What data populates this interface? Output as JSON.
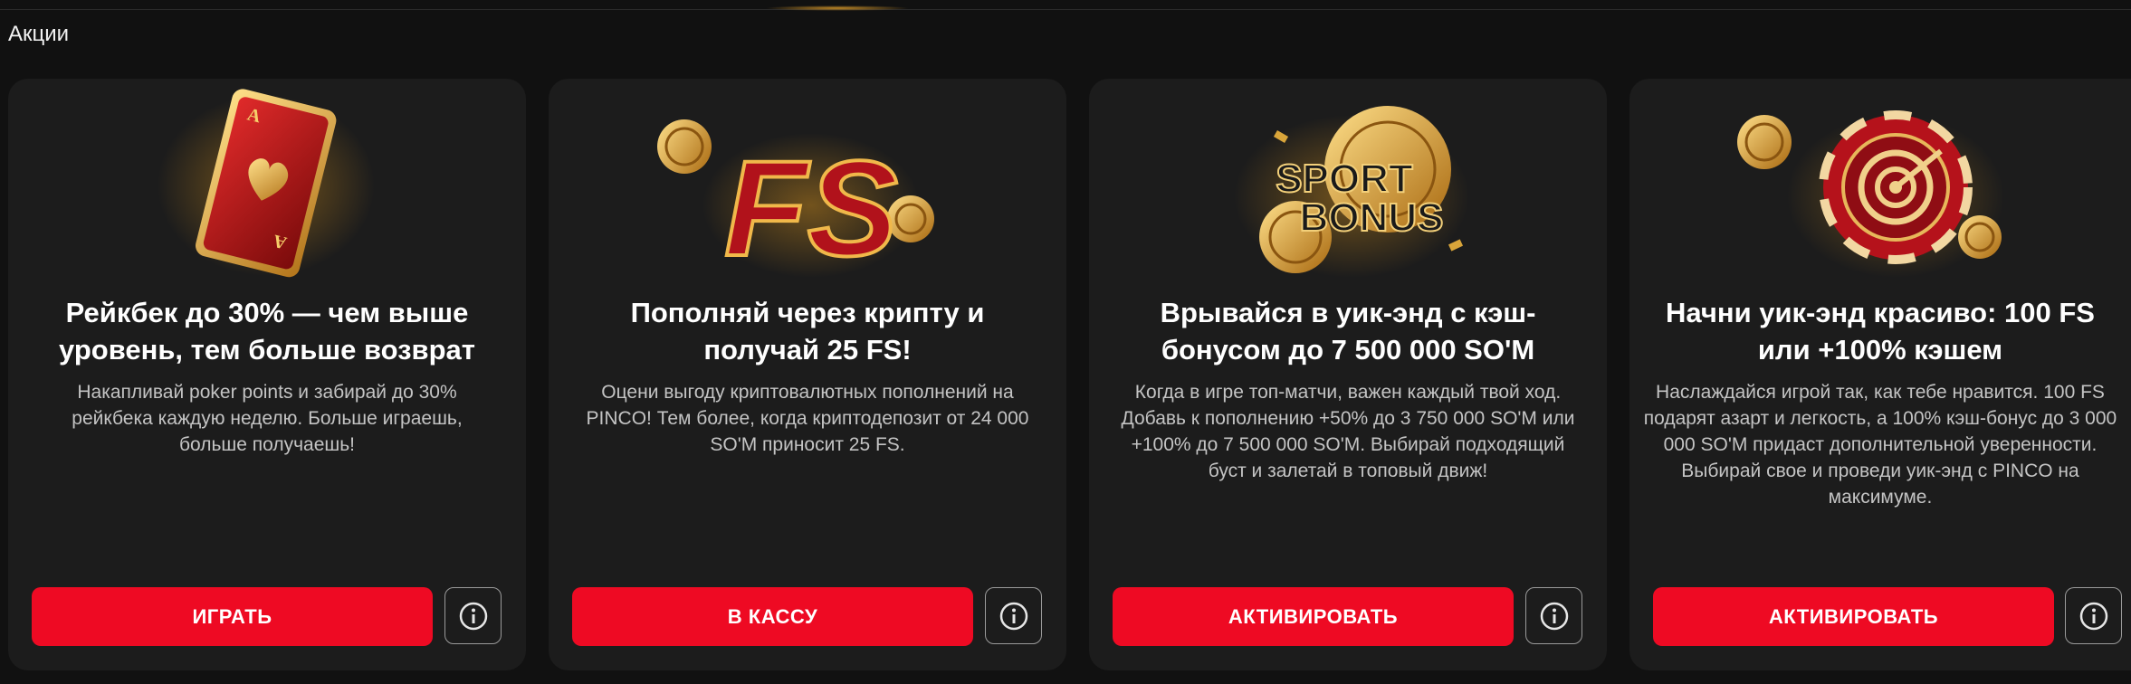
{
  "section": {
    "title": "Акции"
  },
  "promos": [
    {
      "title": "Рейкбек до 30% — чем выше уровень, тем больше возврат",
      "description": "Накапливай poker points и забирай до 30% рейкбека каждую неделю. Больше играешь, больше получаешь!",
      "button": "ИГРАТЬ",
      "art_icon": "gold-playing-card-heart-icon"
    },
    {
      "title": "Пополняй через крипту и получай 25 FS!",
      "description": "Оцени выгоду криптовалютных пополнений на PINCO! Тем более, когда криптодепозит от 24 000 SO'M приносит 25 FS.",
      "button": "В КАССУ",
      "art_icon": "fs-letters-coins-icon",
      "art_text": "FS"
    },
    {
      "title": "Врывайся в уик-энд с кэш-бонусом до 7 500 000 SO'M",
      "description": "Когда в игре топ-матчи, важен каждый твой ход. Добавь к пополнению +50% до 3 750 000 SO'M или +100% до 7 500 000 SO'M. Выбирай подходящий буст и залетай в топовый движ!",
      "button": "АКТИВИРОВАТЬ",
      "art_icon": "sport-bonus-coins-icon",
      "art_text_1": "SPORT",
      "art_text_2": "BONUS"
    },
    {
      "title": "Начни уик-энд красиво: 100 FS или +100% кэшем",
      "description": "Наслаждайся игрой так, как тебе нравится. 100 FS подарят азарт и легкость, а 100% кэш-бонус до 3 000 000 SO'M придаст дополнительной уверенности. Выбирай свое и проведи уик-энд с PINCO на максимуме.",
      "button": "АКТИВИРОВАТЬ",
      "art_icon": "casino-chip-target-icon"
    }
  ],
  "colors": {
    "background": "#111111",
    "card": "#1c1c1c",
    "accent_red": "#ee0a23",
    "gold": "#d4a23a"
  }
}
